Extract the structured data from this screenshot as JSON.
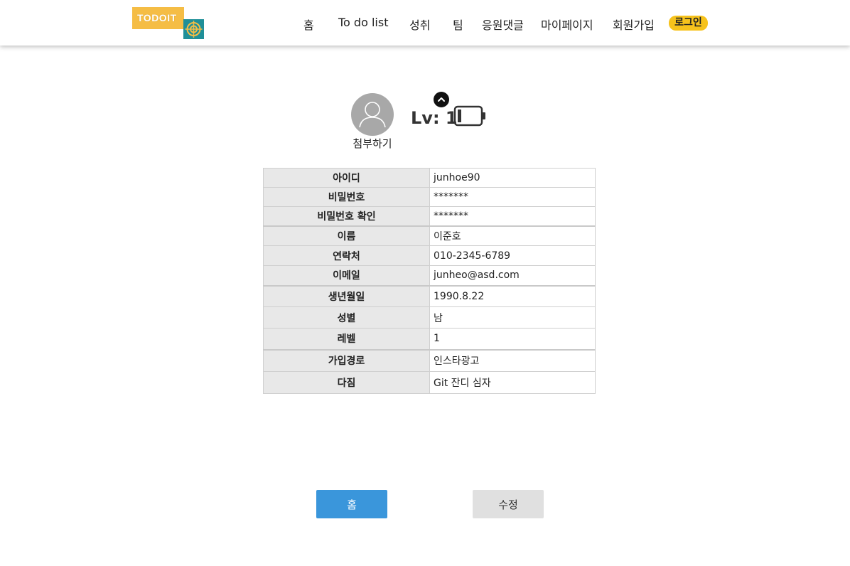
{
  "colors": {
    "accent": "#3a96db",
    "login_badge": "#f6c21c",
    "logo_yellow": "#f5bd45",
    "logo_teal": "#1f8f98",
    "label_bg": "#e8e8e8"
  },
  "header": {
    "logo_text": "TODOIT",
    "nav": [
      "홈",
      "To do list",
      "성취",
      "팀",
      "응원댓글",
      "마이페이지",
      "회원가입"
    ],
    "login": "로그인"
  },
  "profile": {
    "attach_label": "첨부하기",
    "level_label": "Lv: 1",
    "icons": [
      "user-avatar-icon",
      "chevron-up-icon",
      "battery-icon"
    ]
  },
  "table": {
    "rows": [
      {
        "label": "아이디",
        "value": "junhoe90"
      },
      {
        "label": "비밀번호",
        "value": "*******"
      },
      {
        "label": "비밀번호 확인",
        "value": "*******"
      },
      {
        "label": "이름",
        "value": "이준호"
      },
      {
        "label": "연락처",
        "value": "010-2345-6789"
      },
      {
        "label": "이메일",
        "value": "junheo@asd.com"
      },
      {
        "label": "생년월일",
        "value": "1990.8.22"
      },
      {
        "label": "성별",
        "value": "남"
      },
      {
        "label": "레벨",
        "value": "1"
      },
      {
        "label": "가입경로",
        "value": "인스타광고"
      },
      {
        "label": "다짐",
        "value": "Git 잔디 심자"
      }
    ]
  },
  "buttons": {
    "home": "홈",
    "edit": "수정"
  }
}
